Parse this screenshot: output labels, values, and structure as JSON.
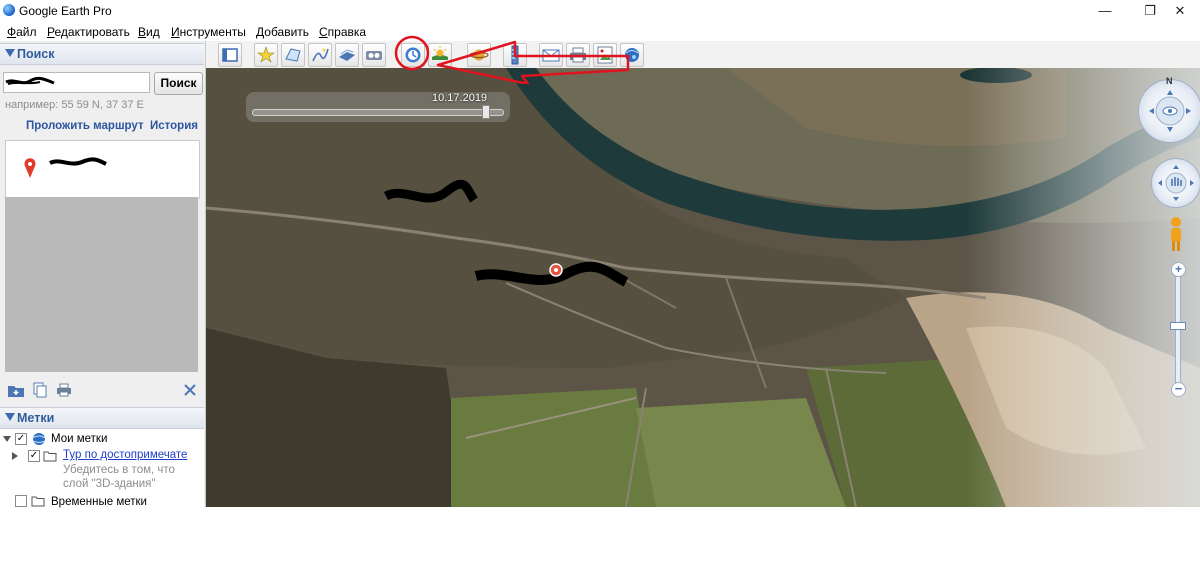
{
  "window": {
    "title": "Google Earth Pro",
    "minimize": "—",
    "restore": "❐",
    "close": "✕"
  },
  "menu": [
    {
      "label": "Файл",
      "u": "Ф",
      "rest": "айл"
    },
    {
      "label": "Редактировать",
      "u": "Р",
      "rest": "едактировать"
    },
    {
      "label": "Вид",
      "u": "В",
      "rest": "ид"
    },
    {
      "label": "Инструменты",
      "u": "И",
      "rest": "нструменты"
    },
    {
      "label": "Добавить",
      "u": "Д",
      "rest": "обавить"
    },
    {
      "label": "Справка",
      "u": "С",
      "rest": "правка"
    }
  ],
  "search": {
    "header": "Поиск",
    "button": "Поиск",
    "hint": "например: 55 59 N, 37 37 E",
    "route_link": "Проложить маршрут",
    "history_link": "История"
  },
  "places": {
    "header": "Метки",
    "my_places": "Мои метки",
    "tour_link": "Тур по достопримечате",
    "tour_note_1": "Убедитесь в том, что",
    "tour_note_2": "слой \"3D-здания\"",
    "temp_places": "Временные метки"
  },
  "map": {
    "time_label": "10.17.2019",
    "compass_north": "N"
  },
  "colors": {
    "accent": "#2f5d9c",
    "annotation": "#e0141e"
  },
  "icons": {
    "sidebar_tools": [
      "add-folder-icon",
      "copy-icon",
      "print-icon",
      "close-icon"
    ],
    "toolbar": [
      "hide-sidebar-icon",
      "add-placemark-icon",
      "add-polygon-icon",
      "add-path-icon",
      "add-image-overlay-icon",
      "record-tour-icon",
      "historical-imagery-icon",
      "sunlight-icon",
      "switch-to-sky-icon",
      "ruler-icon",
      "email-icon",
      "print-icon",
      "save-image-icon",
      "view-in-maps-icon"
    ]
  }
}
